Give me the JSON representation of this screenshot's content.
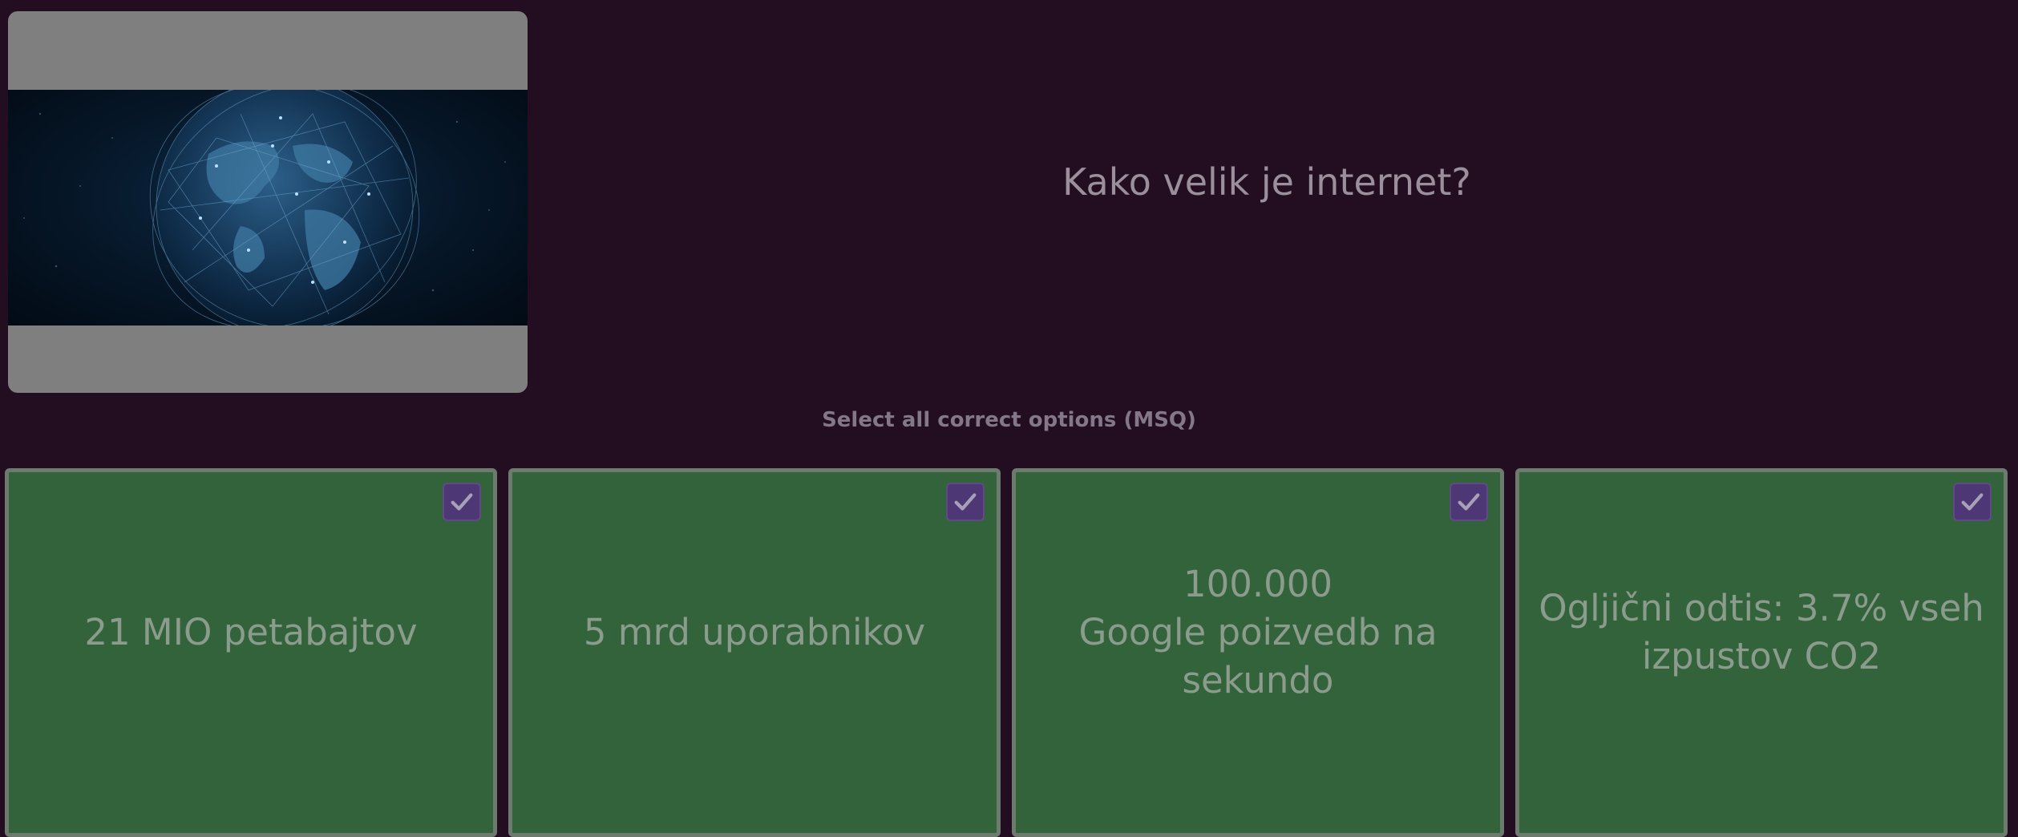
{
  "question": {
    "text": "Kako velik je internet?",
    "type_label": "Select all correct options (MSQ)",
    "image_icon": "globe-network-image"
  },
  "options": [
    {
      "text": "21 MIO petabajtov",
      "selected": true,
      "icon": "check-icon"
    },
    {
      "text": "5 mrd uporabnikov",
      "selected": true,
      "icon": "check-icon"
    },
    {
      "text": "100.000\nGoogle poizvedb na sekundo",
      "selected": true,
      "icon": "check-icon"
    },
    {
      "text": "Ogljični odtis: 3.7% vseh izpustov CO2",
      "selected": true,
      "icon": "check-icon"
    }
  ],
  "colors": {
    "background": "#220d21",
    "option_background": "#33633b",
    "checkbox": "#4d3775",
    "media_frame": "#7f7f7f"
  }
}
